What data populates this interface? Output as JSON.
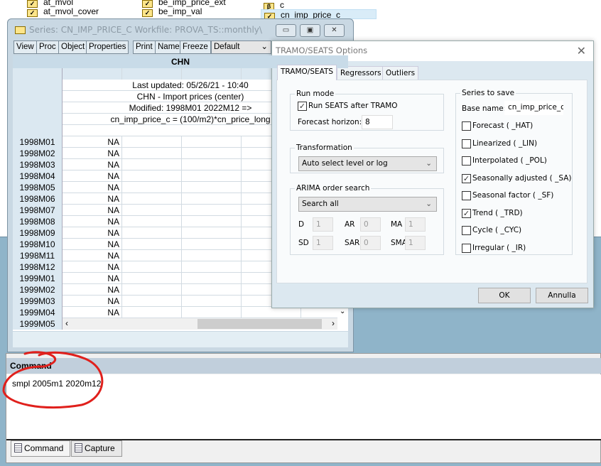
{
  "workfile": {
    "items": [
      {
        "name": "at_mvol",
        "type": "series"
      },
      {
        "name": "at_mvol_cover",
        "type": "series"
      },
      {
        "name": "be_imp_price_ext",
        "type": "series"
      },
      {
        "name": "be_imp_val",
        "type": "series"
      },
      {
        "name": "c",
        "type": "coef"
      },
      {
        "name": "cn_imp_price_c",
        "type": "series",
        "selected": true
      }
    ]
  },
  "series_window": {
    "title": "Series: CN_IMP_PRICE_C    Workfile: PROVA_TS::monthly\\",
    "toolbar": [
      "View",
      "Proc",
      "Object",
      "Properties",
      "Print",
      "Name",
      "Freeze"
    ],
    "view_select": "Default",
    "column_header": "CHN",
    "info": [
      "Last updated: 05/26/21 - 10:40",
      "CHN - Import prices (center)",
      "Modified: 1998M01 2022M12 =>",
      "cn_imp_price_c = (100/m2)*cn_price_long"
    ],
    "rows": [
      [
        "1998M01",
        "NA"
      ],
      [
        "1998M02",
        "NA"
      ],
      [
        "1998M03",
        "NA"
      ],
      [
        "1998M04",
        "NA"
      ],
      [
        "1998M05",
        "NA"
      ],
      [
        "1998M06",
        "NA"
      ],
      [
        "1998M07",
        "NA"
      ],
      [
        "1998M08",
        "NA"
      ],
      [
        "1998M09",
        "NA"
      ],
      [
        "1998M10",
        "NA"
      ],
      [
        "1998M11",
        "NA"
      ],
      [
        "1998M12",
        "NA"
      ],
      [
        "1999M01",
        "NA"
      ],
      [
        "1999M02",
        "NA"
      ],
      [
        "1999M03",
        "NA"
      ],
      [
        "1999M04",
        "NA"
      ],
      [
        "1999M05",
        ""
      ]
    ]
  },
  "dialog": {
    "title": "TRAMO/SEATS Options",
    "tabs": [
      "TRAMO/SEATS",
      "Regressors",
      "Outliers"
    ],
    "run_mode": {
      "legend": "Run mode",
      "run_seats_label": "Run SEATS after TRAMO",
      "run_seats": true,
      "horizon_label": "Forecast horizon:",
      "horizon": "8"
    },
    "transformation": {
      "legend": "Transformation",
      "value": "Auto select level or log"
    },
    "arima": {
      "legend": "ARIMA order search",
      "value": "Search all",
      "fields": [
        {
          "label": "D",
          "value": "1"
        },
        {
          "label": "AR",
          "value": "0"
        },
        {
          "label": "MA",
          "value": "1"
        },
        {
          "label": "SD",
          "value": "1"
        },
        {
          "label": "SAR",
          "value": "0"
        },
        {
          "label": "SMA",
          "value": "1"
        }
      ]
    },
    "save": {
      "legend": "Series to save",
      "base_label": "Base name:",
      "base": "cn_imp_price_c",
      "options": [
        {
          "label": "Forecast ( _HAT)",
          "checked": false
        },
        {
          "label": "Linearized ( _LIN)",
          "checked": false
        },
        {
          "label": "Interpolated ( _POL)",
          "checked": false
        },
        {
          "label": "Seasonally adjusted ( _SA)",
          "checked": true
        },
        {
          "label": "Seasonal factor ( _SF)",
          "checked": false
        },
        {
          "label": "Trend ( _TRD)",
          "checked": true
        },
        {
          "label": "Cycle ( _CYC)",
          "checked": false
        },
        {
          "label": "Irregular ( _IR)",
          "checked": false
        }
      ]
    },
    "ok": "OK",
    "cancel": "Annulla"
  },
  "command": {
    "header": "Command",
    "text": "smpl 2005m1 2020m12",
    "tabs": [
      "Command",
      "Capture"
    ]
  },
  "colors": {
    "desktop": "#8fb4c9",
    "annotation": "#e0201c"
  }
}
